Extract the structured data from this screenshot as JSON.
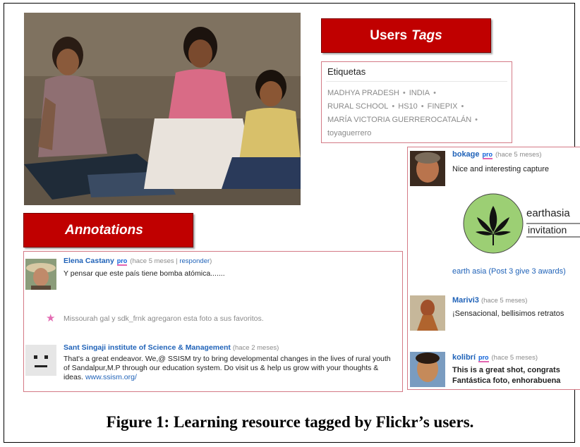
{
  "banners": {
    "users_tags_prefix": "Users",
    "users_tags_suffix": "Tags",
    "annotations": "Annotations"
  },
  "tags": {
    "title": "Etiquetas",
    "items": [
      "MADHYA PRADESH",
      "INDIA",
      "RURAL SCHOOL",
      "HS10",
      "FINEPIX",
      "MARÍA VICTORIA GUERREROCATALÁN",
      "toyaguerrero"
    ],
    "separator": "•"
  },
  "annotations": [
    {
      "user": "Elena Castany",
      "pro": "pro",
      "time": "(hace 5 meses",
      "reply": "responder",
      "text": "Y pensar que este país tiene bomba atómica......."
    },
    {
      "text": "Missourah gal y sdk_frnk agregaron esta foto a sus favoritos."
    },
    {
      "user": "Sant Singaji institute of Science & Management",
      "time": "(hace 2 meses)",
      "text": "That's a great endeavor. We,@ SSISM try to bring developmental changes in the lives of rural youth of Sandalpur,M.P through our education system. Do visit us & help us grow with your thoughts & ideas.",
      "link": "www.ssism.org/"
    }
  ],
  "right_comments": [
    {
      "user": "bokage",
      "pro": "pro",
      "time": "(hace 5 meses)",
      "text": "Nice and interesting capture"
    },
    {
      "logo_line1": "earthasia",
      "logo_line2": "invitation",
      "link": "earth asia (Post 3 give 3 awards)"
    },
    {
      "user": "Marivi3",
      "time": "(hace 5 meses)",
      "text": "¡Sensacional, bellisimos retratos"
    },
    {
      "user": "kolibrí",
      "pro": "pro",
      "time": "(hace 5 meses)",
      "text": "This is a great shot, congrats",
      "text2": "Fantástica foto, enhorabuena"
    }
  ],
  "caption": "Figure 1: Learning resource tagged by Flickr’s users.",
  "colors": {
    "banner_red": "#c00000",
    "box_border": "#d47a86",
    "link_blue": "#1f62b8",
    "pro_underline": "#e366b0"
  }
}
